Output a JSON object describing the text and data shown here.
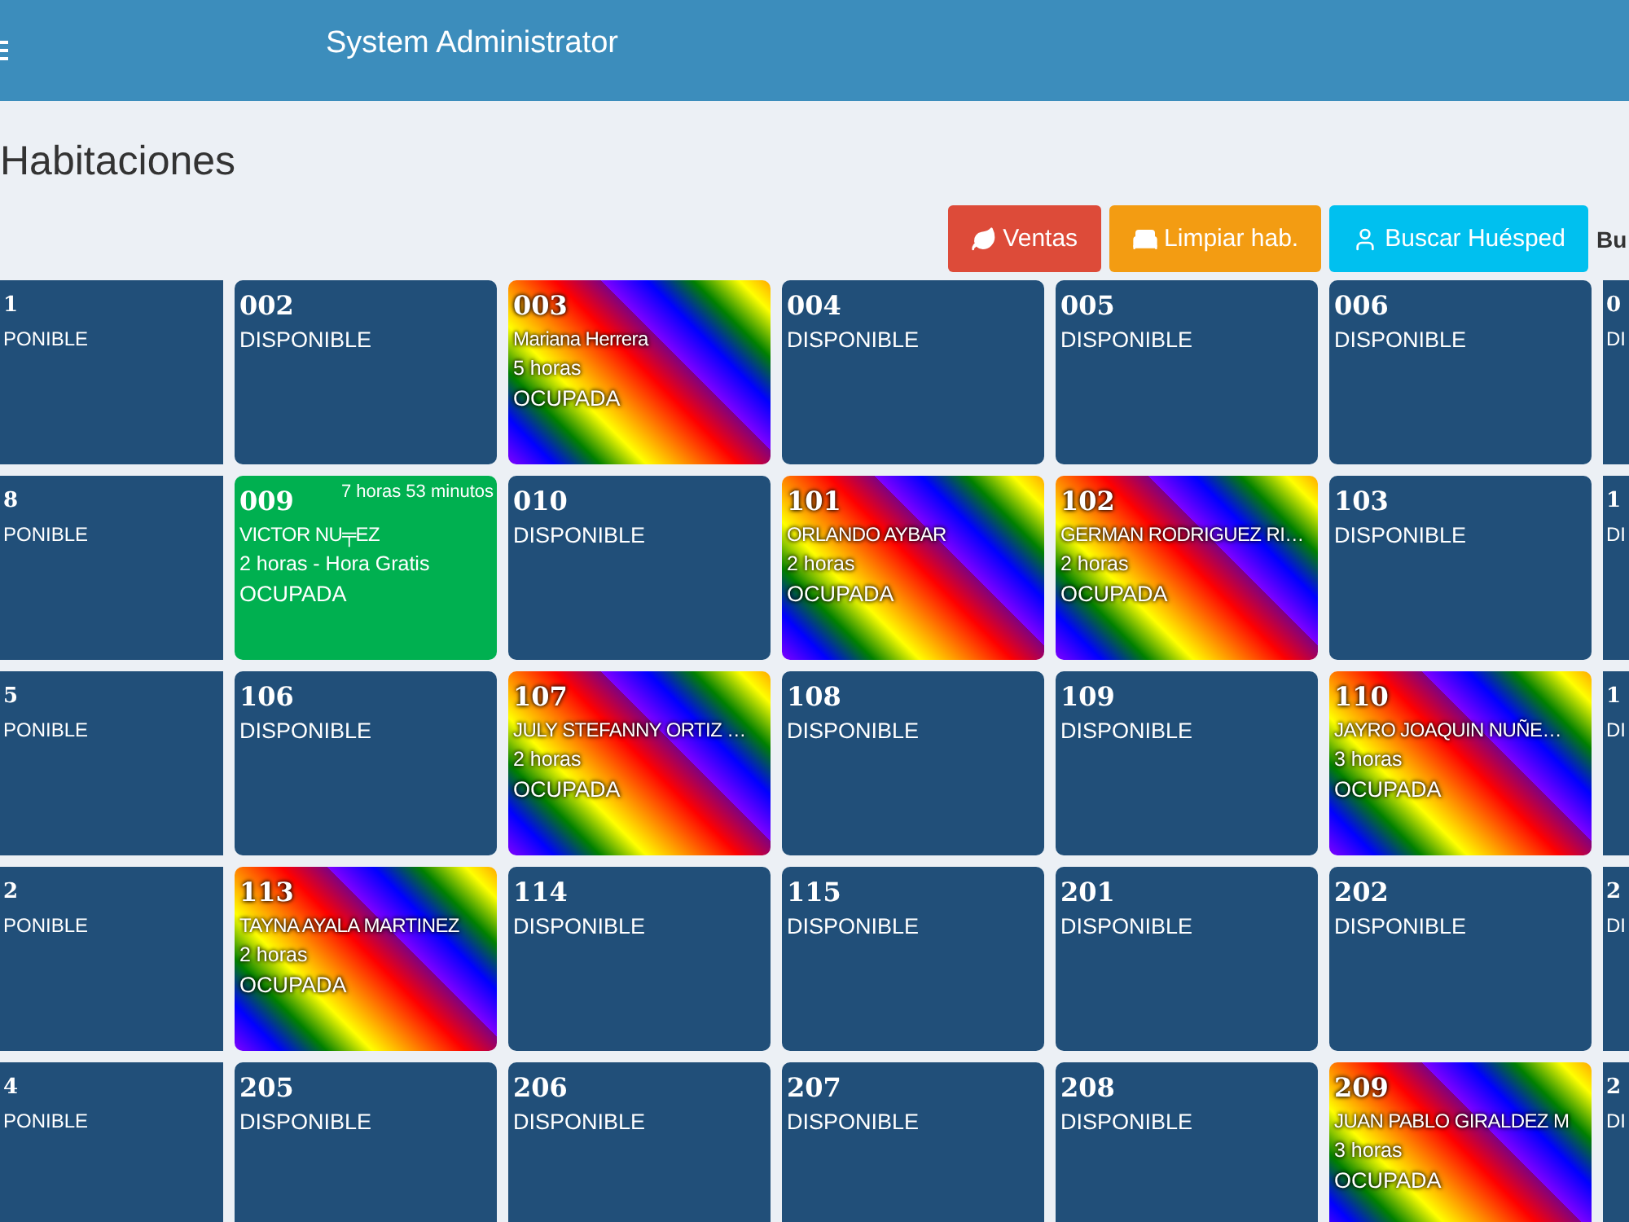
{
  "header": {
    "user": "System Administrator"
  },
  "page": {
    "title": "Habitaciones"
  },
  "actions": [
    {
      "label": "Ventas",
      "kind": "sales"
    },
    {
      "label": "Limpiar hab.",
      "kind": "clean"
    },
    {
      "label": "Buscar Huésped",
      "kind": "guest"
    }
  ],
  "toolbar_cut_text": "Bu",
  "rooms": [
    [
      {
        "number": "1",
        "status": "PONIBLE",
        "kind": "free"
      },
      {
        "number": "002",
        "status": "DISPONIBLE",
        "kind": "free"
      },
      {
        "number": "003",
        "guest": "Mariana Herrera",
        "duration": "5 horas",
        "status": "OCUPADA",
        "kind": "occupied"
      },
      {
        "number": "004",
        "status": "DISPONIBLE",
        "kind": "free"
      },
      {
        "number": "005",
        "status": "DISPONIBLE",
        "kind": "free"
      },
      {
        "number": "006",
        "status": "DISPONIBLE",
        "kind": "free"
      },
      {
        "number": "0",
        "status": "DI",
        "kind": "free"
      }
    ],
    [
      {
        "number": "8",
        "status": "PONIBLE",
        "kind": "free"
      },
      {
        "number": "009",
        "timer": "7 horas 53 minutos",
        "guest": "VICTOR NU╤EZ",
        "duration": "2 horas - Hora Gratis",
        "status": "OCUPADA",
        "kind": "timed"
      },
      {
        "number": "010",
        "status": "DISPONIBLE",
        "kind": "free"
      },
      {
        "number": "101",
        "guest": "ORLANDO AYBAR",
        "duration": "2 horas",
        "status": "OCUPADA",
        "kind": "occupied"
      },
      {
        "number": "102",
        "guest": "GERMAN RODRIGUEZ RI…",
        "duration": "2 horas",
        "status": "OCUPADA",
        "kind": "occupied"
      },
      {
        "number": "103",
        "status": "DISPONIBLE",
        "kind": "free"
      },
      {
        "number": "1",
        "status": "DI",
        "kind": "free"
      }
    ],
    [
      {
        "number": "5",
        "status": "PONIBLE",
        "kind": "free"
      },
      {
        "number": "106",
        "status": "DISPONIBLE",
        "kind": "free"
      },
      {
        "number": "107",
        "guest": "JULY STEFANNY ORTIZ …",
        "duration": "2 horas",
        "status": "OCUPADA",
        "kind": "occupied"
      },
      {
        "number": "108",
        "status": "DISPONIBLE",
        "kind": "free"
      },
      {
        "number": "109",
        "status": "DISPONIBLE",
        "kind": "free"
      },
      {
        "number": "110",
        "guest": "JAYRO JOAQUIN NUÑE…",
        "duration": "3 horas",
        "status": "OCUPADA",
        "kind": "occupied"
      },
      {
        "number": "1",
        "status": "DI",
        "kind": "free"
      }
    ],
    [
      {
        "number": "2",
        "status": "PONIBLE",
        "kind": "free"
      },
      {
        "number": "113",
        "guest": "TAYNA AYALA MARTINEZ",
        "duration": "2 horas",
        "status": "OCUPADA",
        "kind": "occupied"
      },
      {
        "number": "114",
        "status": "DISPONIBLE",
        "kind": "free"
      },
      {
        "number": "115",
        "status": "DISPONIBLE",
        "kind": "free"
      },
      {
        "number": "201",
        "status": "DISPONIBLE",
        "kind": "free"
      },
      {
        "number": "202",
        "status": "DISPONIBLE",
        "kind": "free"
      },
      {
        "number": "2",
        "status": "DI",
        "kind": "free"
      }
    ],
    [
      {
        "number": "4",
        "status": "PONIBLE",
        "kind": "free"
      },
      {
        "number": "205",
        "status": "DISPONIBLE",
        "kind": "free"
      },
      {
        "number": "206",
        "status": "DISPONIBLE",
        "kind": "free"
      },
      {
        "number": "207",
        "status": "DISPONIBLE",
        "kind": "free"
      },
      {
        "number": "208",
        "status": "DISPONIBLE",
        "kind": "free"
      },
      {
        "number": "209",
        "guest": "JUAN PABLO GIRALDEZ M",
        "duration": "3 horas",
        "status": "OCUPADA",
        "kind": "occupied"
      },
      {
        "number": "2",
        "status": "DI",
        "kind": "free"
      }
    ]
  ]
}
